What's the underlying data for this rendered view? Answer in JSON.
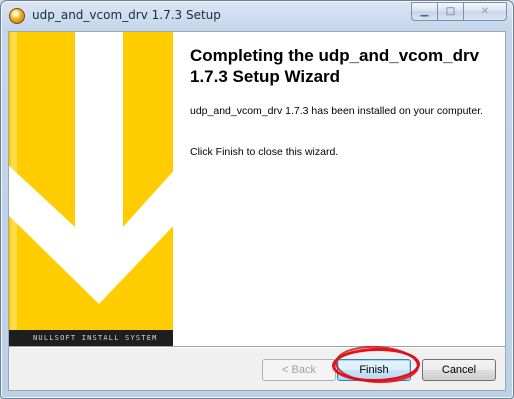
{
  "window": {
    "title": "udp_and_vcom_drv 1.7.3 Setup",
    "min_symbol": "▁",
    "max_symbol": "□",
    "close_symbol": "✕"
  },
  "banner": {
    "brand": "NULLSOFT INSTALL SYSTEM",
    "colors": {
      "background": "#ffcc00",
      "arrow": "#ffffff",
      "bar": "#1e1e1e"
    }
  },
  "content": {
    "heading": "Completing the udp_and_vcom_drv 1.7.3 Setup Wizard",
    "paragraph1": "udp_and_vcom_drv 1.7.3 has been installed on your computer.",
    "paragraph2": "Click Finish to close this wizard."
  },
  "buttons": {
    "back": "< Back",
    "finish": "Finish",
    "cancel": "Cancel"
  },
  "annotation": {
    "color": "#e3131b",
    "shape": "ellipse around Finish button"
  }
}
